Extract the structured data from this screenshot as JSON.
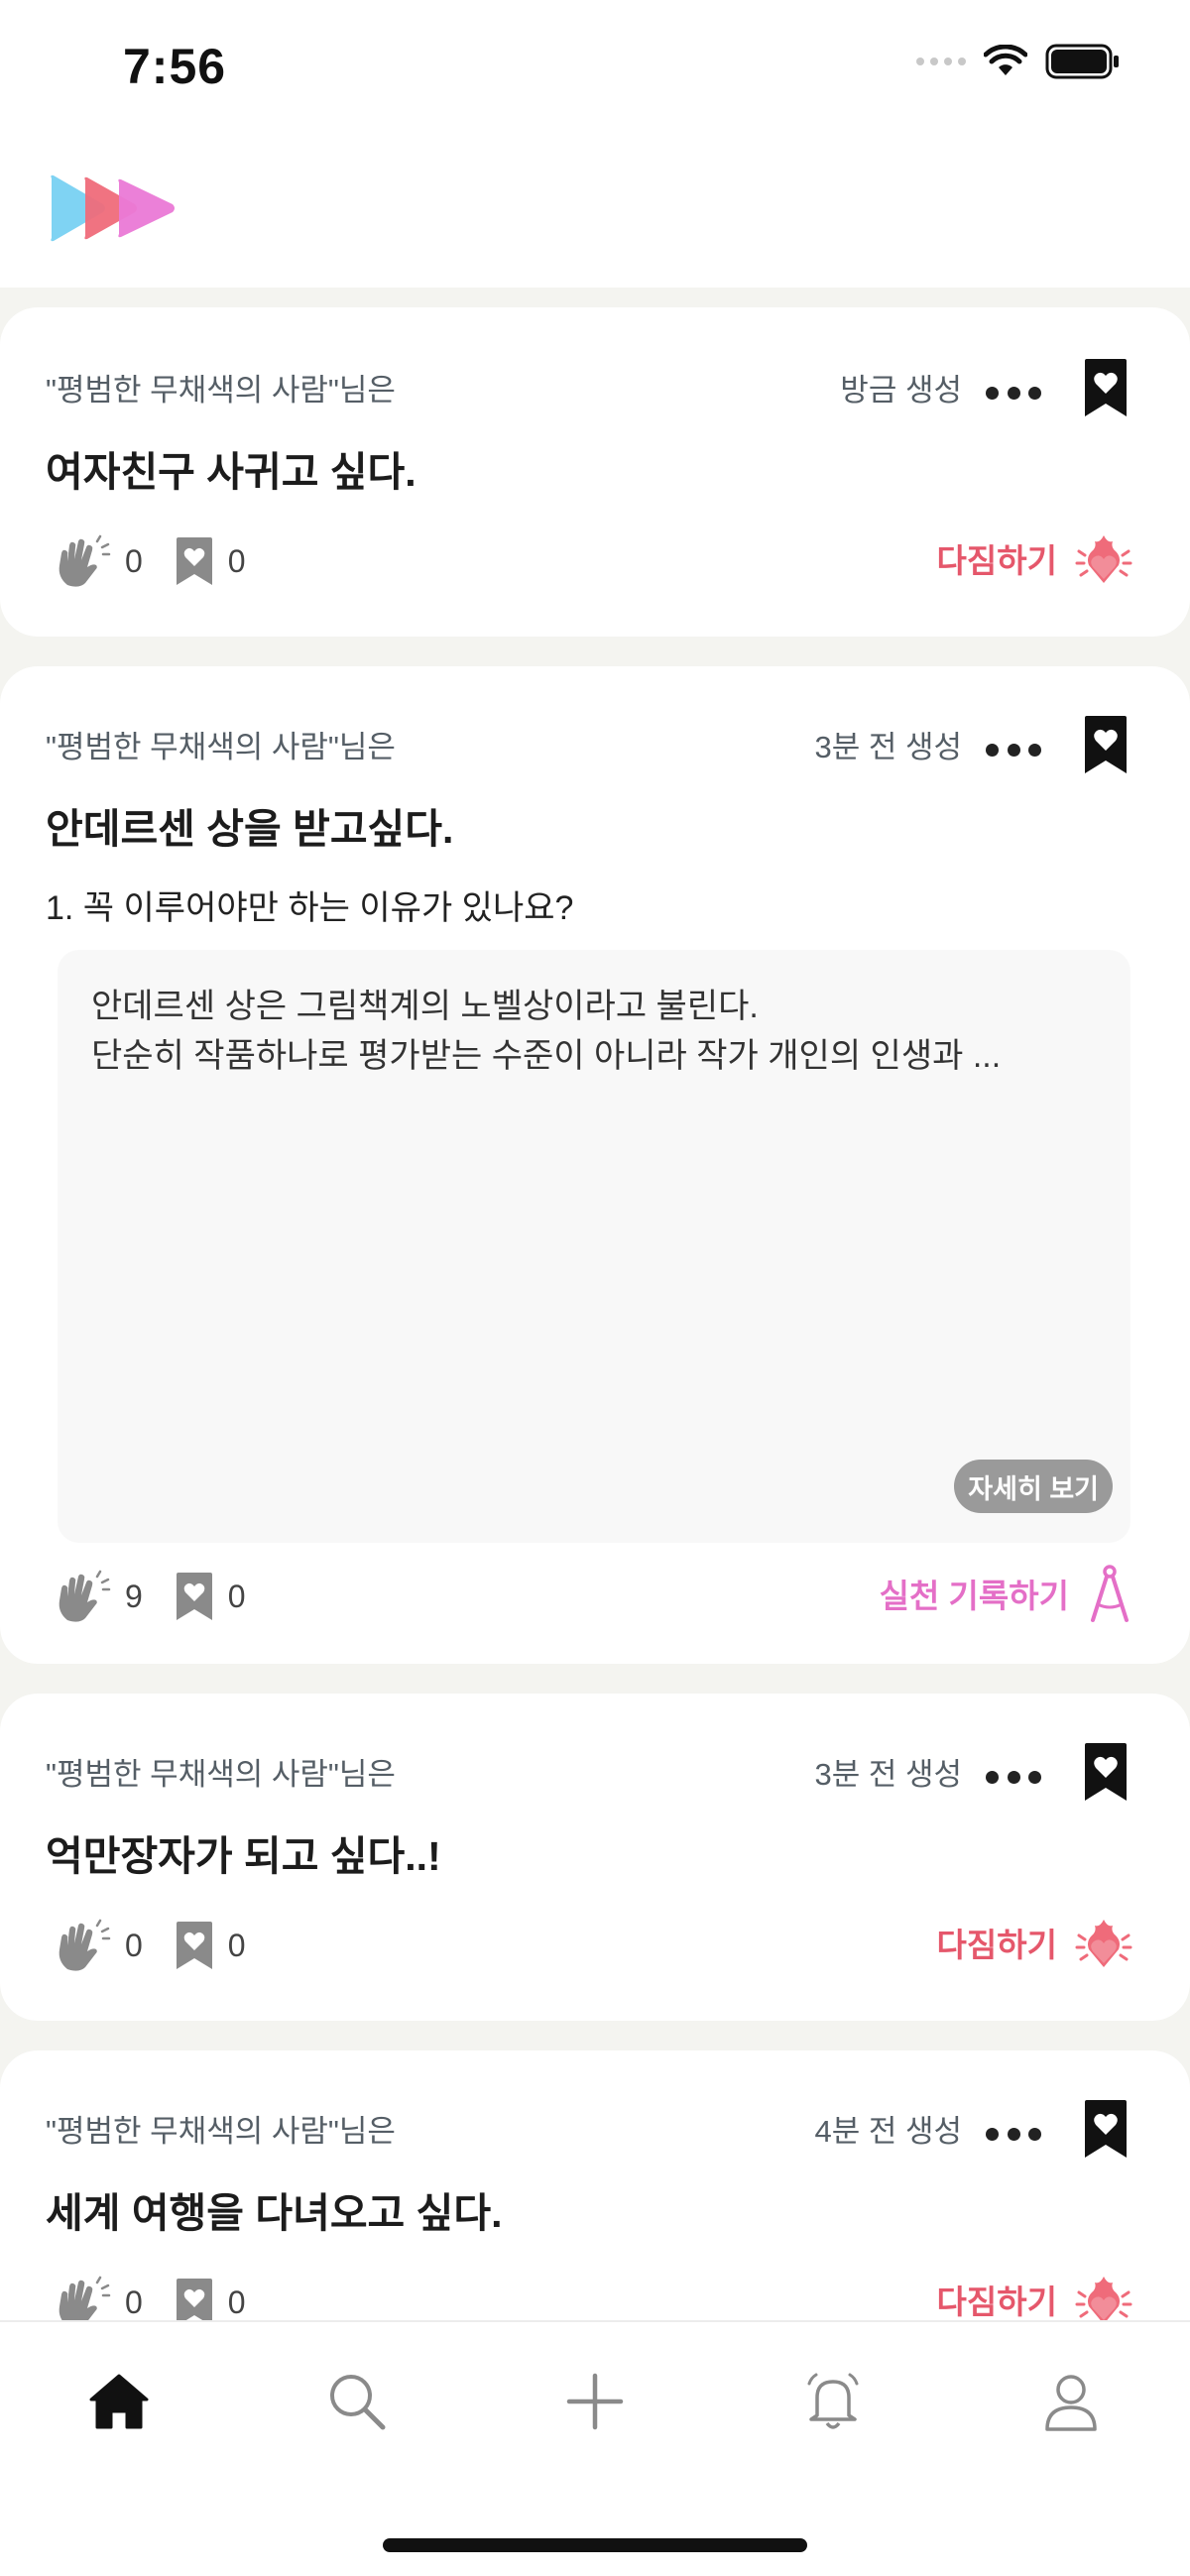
{
  "status_bar": {
    "time": "7:56"
  },
  "colors": {
    "pledge": "#e5576b",
    "practice": "#e46fc7",
    "logo": [
      "#7fd3f3",
      "#ef6b7a",
      "#ea79d6"
    ]
  },
  "posts": [
    {
      "nickname": "\"평범한 무채색의 사람\"님은",
      "time": "방금 생성",
      "title": "여자친구 사귀고 싶다.",
      "clap_count": "0",
      "bookmark_count": "0",
      "action_label": "다짐하기",
      "action_icon": "fire-heart-icon"
    },
    {
      "nickname": "\"평범한 무채색의 사람\"님은",
      "time": "3분 전 생성",
      "title": "안데르센 상을 받고싶다.",
      "question": "1. 꼭 이루어야만 하는 이유가 있나요?",
      "answer": "안데르센 상은 그림책계의 노벨상이라고 불린다.\n단순히 작품하나로 평가받는 수준이 아니라 작가 개인의 인생과 ...",
      "detail_label": "자세히 보기",
      "clap_count": "9",
      "bookmark_count": "0",
      "action_label": "실천 기록하기",
      "action_icon": "compass-icon"
    },
    {
      "nickname": "\"평범한 무채색의 사람\"님은",
      "time": "3분 전 생성",
      "title": "억만장자가 되고 싶다..!",
      "clap_count": "0",
      "bookmark_count": "0",
      "action_label": "다짐하기",
      "action_icon": "fire-heart-icon"
    },
    {
      "nickname": "\"평범한 무채색의 사람\"님은",
      "time": "4분 전 생성",
      "title": "세계 여행을 다녀오고 싶다.",
      "clap_count": "0",
      "bookmark_count": "0",
      "action_label": "다짐하기",
      "action_icon": "fire-heart-icon"
    }
  ],
  "tabbar": {
    "tabs": [
      "home-icon",
      "search-icon",
      "plus-icon",
      "bell-icon",
      "profile-icon"
    ],
    "active": "home-icon"
  }
}
